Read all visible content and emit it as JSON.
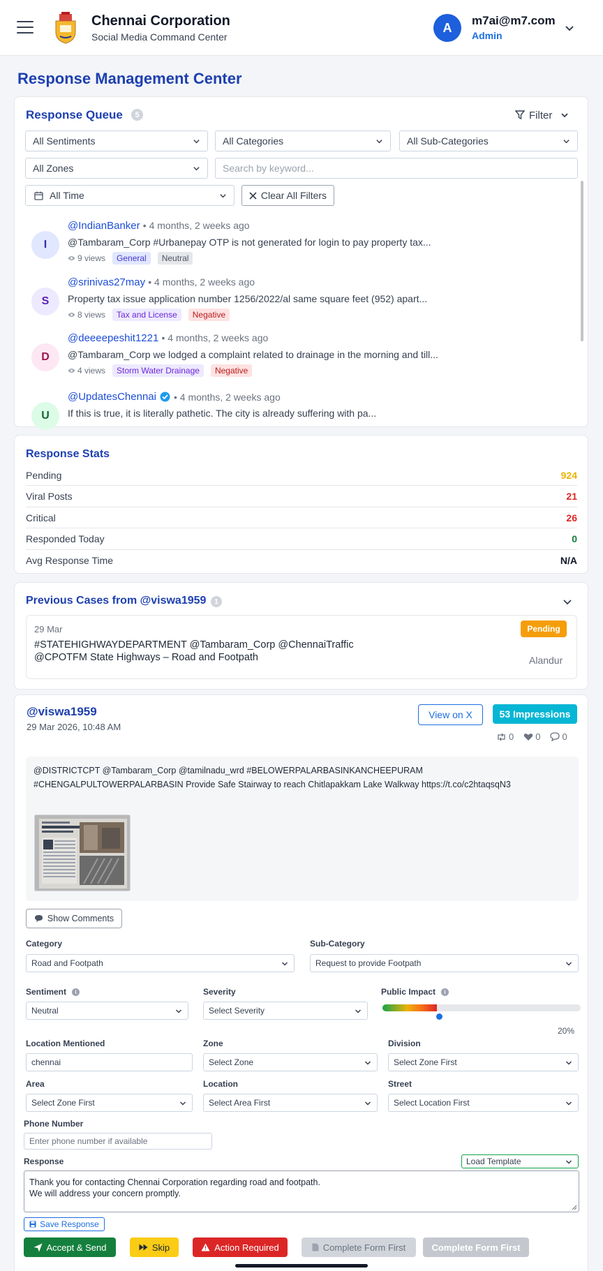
{
  "header": {
    "org_name": "Chennai Corporation",
    "subtitle": "Social Media Command Center",
    "user": {
      "avatar_initial": "A",
      "email": "m7ai@m7.com",
      "role": "Admin"
    }
  },
  "page_title": "Response Management Center",
  "queue": {
    "title": "Response Queue",
    "count": "5",
    "filter_label": "Filter",
    "filters": {
      "sentiment": "All Sentiments",
      "category": "All Categories",
      "subcategory": "All Sub-Categories",
      "zone": "All Zones",
      "search_placeholder": "Search by keyword...",
      "time": "All Time",
      "clear_label": "Clear All Filters"
    },
    "items": [
      {
        "initial": "I",
        "handle": "@IndianBanker",
        "time": "• 4 months, 2 weeks ago",
        "text": "@Tambaram_Corp #Urbanepay OTP is not generated for login to pay property tax...",
        "views": "9 views",
        "category": "General",
        "sentiment": "Neutral"
      },
      {
        "initial": "S",
        "handle": "@srinivas27may",
        "time": "• 4 months, 2 weeks ago",
        "text": "Property tax issue application number 1256/2022/al same square feet (952) apart...",
        "views": "8 views",
        "category": "Tax and License",
        "sentiment": "Negative"
      },
      {
        "initial": "D",
        "handle": "@deeeepeshit1221",
        "time": "• 4 months, 2 weeks ago",
        "text": "@Tambaram_Corp we lodged a complaint related to drainage in the morning and till...",
        "views": "4 views",
        "category": "Storm Water Drainage",
        "sentiment": "Negative"
      },
      {
        "initial": "U",
        "handle": "@UpdatesChennai",
        "time": "• 4 months, 2 weeks ago",
        "text": "If this is true, it is literally pathetic. The city is already suffering with pa..."
      }
    ]
  },
  "stats": {
    "title": "Response Stats",
    "rows": [
      {
        "label": "Pending",
        "value": "924",
        "color": "#eab308"
      },
      {
        "label": "Viral Posts",
        "value": "21",
        "color": "#dc2626"
      },
      {
        "label": "Critical",
        "value": "26",
        "color": "#dc2626"
      },
      {
        "label": "Responded Today",
        "value": "0",
        "color": "#15803d"
      },
      {
        "label": "Avg Response Time",
        "value": "N/A",
        "color": "#111827"
      }
    ]
  },
  "previous_cases": {
    "title": "Previous Cases from @viswa1959",
    "count": "1",
    "case": {
      "date": "29 Mar",
      "text": "#STATEHIGHWAYDEPARTMENT @Tambaram_Corp @ChennaiTraffic @CPOTFM State Highways – Road and Footpath",
      "status": "Pending",
      "zone": "Alandur"
    }
  },
  "detail": {
    "handle": "@viswa1959",
    "date": "29 Mar 2026, 10:48 AM",
    "view_label": "View on X",
    "impressions": "53 Impressions",
    "retweets": "0",
    "likes": "0",
    "replies": "0",
    "tweet_text": "@DISTRICTCPT @Tambaram_Corp @tamilnadu_wrd #BELOWERPALARBASINKANCHEEPURAM #CHENGALPULTOWERPALARBASIN Provide Safe Stairway to reach Chitlapakkam Lake Walkway https://t.co/c2htaqsqN3",
    "comments_label": "Show Comments",
    "form": {
      "category_label": "Category",
      "category_value": "Road and Footpath",
      "subcategory_label": "Sub-Category",
      "subcategory_value": "Request to provide Footpath",
      "sentiment_label": "Sentiment",
      "sentiment_value": "Neutral",
      "severity_label": "Severity",
      "severity_value": "Select Severity",
      "impact_label": "Public Impact",
      "impact_value": 20,
      "impact_text": "20%",
      "location_label": "Location Mentioned",
      "location_value": "chennai",
      "zone_label": "Zone",
      "zone_value": "Select Zone",
      "division_label": "Division",
      "division_value": "Select Zone First",
      "area_label": "Area",
      "area_value": "Select Zone First",
      "loc_label": "Location",
      "loc_value": "Select Area First",
      "street_label": "Street",
      "street_value": "Select Location First",
      "phone_label": "Phone Number",
      "phone_placeholder": "Enter phone number if available",
      "response_label": "Response",
      "template_label": "Load Template",
      "response_line1": "Thank you for contacting Chennai Corporation regarding road and footpath.",
      "response_line2": "We will address your concern promptly."
    },
    "buttons": {
      "save": "Save Response",
      "accept": "Accept & Send",
      "skip": "Skip",
      "action": "Action Required",
      "complete1": "Complete Form First",
      "complete2": "Complete Form First"
    }
  }
}
